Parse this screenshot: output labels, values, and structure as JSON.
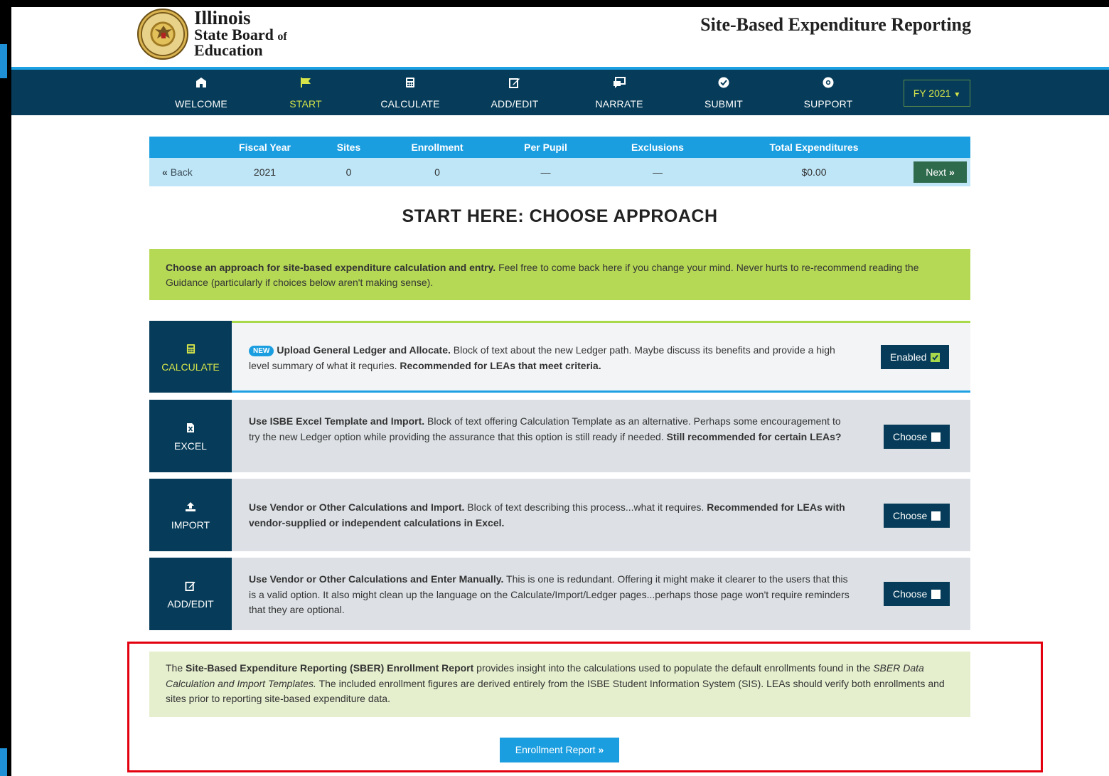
{
  "header": {
    "brand_line1": "Illinois",
    "brand_line2": "State Board",
    "brand_line2_of": "of",
    "brand_line3": "Education",
    "site_title": "Site-Based Expenditure Reporting"
  },
  "nav": {
    "items": [
      {
        "label": "WELCOME",
        "icon": "school-icon"
      },
      {
        "label": "START",
        "icon": "flag-icon"
      },
      {
        "label": "CALCULATE",
        "icon": "calculator-icon"
      },
      {
        "label": "ADD/EDIT",
        "icon": "edit-icon"
      },
      {
        "label": "NARRATE",
        "icon": "chat-icon"
      },
      {
        "label": "SUBMIT",
        "icon": "check-circle-icon"
      },
      {
        "label": "SUPPORT",
        "icon": "lifebuoy-icon"
      }
    ],
    "active": "START",
    "fiscal_year_select": "FY 2021"
  },
  "summary": {
    "headers": [
      "Fiscal Year",
      "Sites",
      "Enrollment",
      "Per Pupil",
      "Exclusions",
      "Total Expenditures"
    ],
    "values": [
      "2021",
      "0",
      "0",
      "—",
      "—",
      "$0.00"
    ],
    "back_label": "Back",
    "next_label": "Next"
  },
  "page_title": "START HERE: CHOOSE APPROACH",
  "intro": {
    "bold": "Choose an approach for site-based expenditure calculation and entry.",
    "text": " Feel free to come back here if you change your mind. Never hurts to re-recommend reading the Guidance (particularly if choices below aren't making sense)."
  },
  "options": [
    {
      "side_label": "CALCULATE",
      "badge": "NEW",
      "title": "Upload General Ledger and Allocate.",
      "text": " Block of text about the new Ledger path. Maybe discuss its benefits and provide a high level summary of what it requries. ",
      "bold_tail": "Recommended for LEAs that meet criteria.",
      "button": "Enabled",
      "selected": true
    },
    {
      "side_label": "EXCEL",
      "title": "Use ISBE Excel Template and Import.",
      "text": " Block of text offering Calculation Template as an alternative. Perhaps some encouragement to try the new Ledger option while providing the assurance that this option is still ready if needed. ",
      "bold_tail": "Still recommended for certain LEAs?",
      "button": "Choose",
      "selected": false
    },
    {
      "side_label": "IMPORT",
      "title": "Use Vendor or Other Calculations and Import.",
      "text": " Block of text describing this process...what it requires. ",
      "bold_tail": "Recommended for LEAs with vendor-supplied or independent calculations in Excel.",
      "button": "Choose",
      "selected": false
    },
    {
      "side_label": "ADD/EDIT",
      "title": "Use Vendor or Other Calculations and Enter Manually.",
      "text": " This is one is redundant. Offering it might make it clearer to the users that this is a valid option. It also might clean up the language on the Calculate/Import/Ledger pages...perhaps those page won't require reminders that they are optional.",
      "bold_tail": "",
      "button": "Choose",
      "selected": false
    }
  ],
  "enrollment": {
    "pre": "The ",
    "bold": "Site-Based Expenditure Reporting (SBER) Enrollment Report",
    "mid": " provides insight into the calculations used to populate the default enrollments found in the ",
    "italic": "SBER Data Calculation and Import Templates.",
    "post": " The included enrollment figures are derived entirely from the ISBE Student Information System (SIS). LEAs should verify both enrollments and sites prior to reporting site-based expenditure data.",
    "button": "Enrollment Report"
  },
  "colors": {
    "nav_bg": "#063c59",
    "accent_blue": "#1b9ee0",
    "active_green": "#d6e44a",
    "intro_green": "#b6d955",
    "highlight_red": "#e3000f"
  }
}
